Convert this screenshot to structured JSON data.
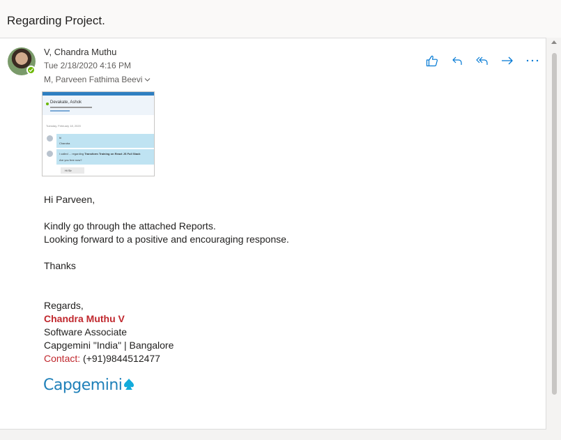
{
  "subject": "Regarding Project.",
  "message": {
    "sender": "V, Chandra Muthu",
    "date": "Tue 2/18/2020 4:16 PM",
    "recipient": "M, Parveen Fathima Beevi"
  },
  "actions": [
    {
      "name": "like-button",
      "icon": "thumbs-up-icon"
    },
    {
      "name": "reply-button",
      "icon": "reply-icon"
    },
    {
      "name": "reply-all-button",
      "icon": "reply-all-icon"
    },
    {
      "name": "forward-button",
      "icon": "forward-arrow-icon"
    },
    {
      "name": "more-actions-button",
      "icon": "more-dots-icon"
    }
  ],
  "attachment_preview": {
    "contact_name": "Devakate, Ashok",
    "date_line": "Tuesday, February 18, 2020",
    "msg1_a": "hi",
    "msg1_b": "Chandra",
    "msg2_a": "I called ... regarding",
    "msg2_bold": "Transform Training on React JS Full Stack",
    "msg2_b": "Are you free now?",
    "reply": "Hi Sir"
  },
  "body": {
    "greeting": "Hi Parveen,",
    "line1": "Kindly go through the attached Reports.",
    "line2": "Looking forward to a positive and encouraging response.",
    "thanks": "Thanks",
    "regards": "Regards,",
    "sig_name": "Chandra Muthu V",
    "sig_title": "Software Associate",
    "sig_company": "Capgemini \"India\" | Bangalore",
    "contact_label": "Contact:",
    "contact_value": " (+91)9844512477"
  },
  "logo_text": "Capgemini",
  "colors": {
    "accent": "#0078d4",
    "signature_red": "#c0272d",
    "presence_green": "#6bb700",
    "logo_blue": "#1f80b9"
  }
}
